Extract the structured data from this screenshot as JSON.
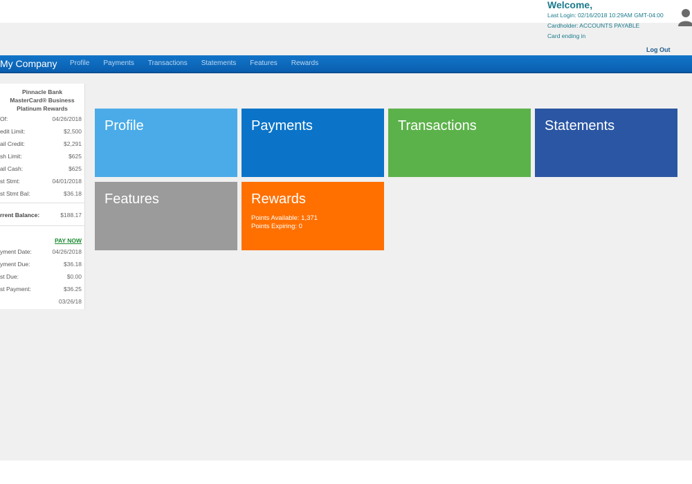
{
  "header": {
    "welcome": "Welcome,",
    "last_login": "Last Login: 02/16/2018 10:29AM GMT-04:00",
    "cardholder": "Cardholder: ACCOUNTS PAYABLE",
    "card_ending": "Card ending in",
    "logout": "Log Out"
  },
  "nav": {
    "brand": "My Company",
    "items": [
      "Profile",
      "Payments",
      "Transactions",
      "Statements",
      "Features",
      "Rewards"
    ]
  },
  "sidebar": {
    "bank": "Pinnacle Bank",
    "card": "MasterCard® Business",
    "program": "Platinum Rewards",
    "rows": [
      {
        "label": "Of:",
        "value": "04/26/2018"
      },
      {
        "label": "edit Limit:",
        "value": "$2,500"
      },
      {
        "label": "ail Credit:",
        "value": "$2,291"
      },
      {
        "label": "sh Limit:",
        "value": "$625"
      },
      {
        "label": "ail Cash:",
        "value": "$625"
      },
      {
        "label": "st Stmt:",
        "value": "04/01/2018"
      },
      {
        "label": "st Stmt Bal:",
        "value": "$36.18"
      }
    ],
    "balance": {
      "label": "rrent Balance:",
      "value": "$188.17"
    },
    "pay_now": "PAY NOW",
    "payment_rows": [
      {
        "label": "yment Date:",
        "value": "04/26/2018"
      },
      {
        "label": "yment Due:",
        "value": "$36.18"
      },
      {
        "label": "st Due:",
        "value": "$0.00"
      },
      {
        "label": "st Payment:",
        "value": "$36.25"
      },
      {
        "label": "",
        "value": "03/26/18"
      }
    ]
  },
  "tiles": {
    "profile": {
      "title": "Profile",
      "color": "#4aabe8"
    },
    "payments": {
      "title": "Payments",
      "color": "#0b74c8"
    },
    "transactions": {
      "title": "Transactions",
      "color": "#5cb24a"
    },
    "statements": {
      "title": "Statements",
      "color": "#2a56a3"
    },
    "features": {
      "title": "Features",
      "color": "#9b9b9b"
    },
    "rewards": {
      "title": "Rewards",
      "color": "#ff7000",
      "points_available": "Points Available: 1,371",
      "points_expiring": "Points Expiring: 0"
    }
  },
  "icons": {
    "user": "user-icon"
  }
}
